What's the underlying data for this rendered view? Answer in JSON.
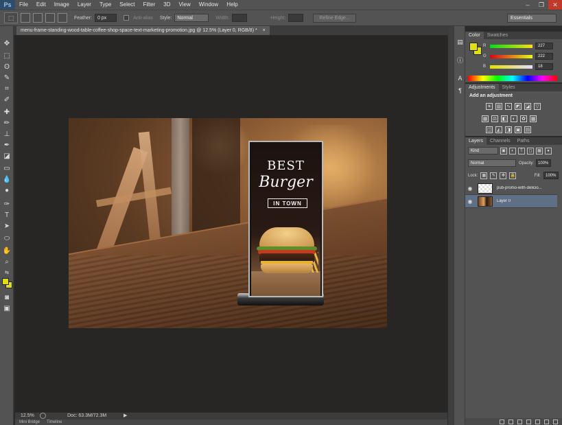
{
  "menubar": {
    "logo": "Ps",
    "items": [
      "File",
      "Edit",
      "Image",
      "Layer",
      "Type",
      "Select",
      "Filter",
      "3D",
      "View",
      "Window",
      "Help"
    ],
    "window_controls": [
      "–",
      "❐",
      "✕"
    ]
  },
  "options": {
    "feather_label": "Feather:",
    "feather_value": "0 px",
    "antialias_label": "Anti-alias",
    "style_label": "Style:",
    "style_value": "Normal",
    "width_label": "Width:",
    "height_label": "Height:",
    "refine_edge": "Refine Edge...",
    "workspace": "Essentials"
  },
  "document": {
    "tab_title": "menu-frame-standing-wood-table-coffee-shop-space-text-marketing-promotion.jpg @ 12.5% (Layer 0, RGB/8) *",
    "tab_close": "×",
    "zoom": "12.5%",
    "doc_size": "Doc: 63.3M/72.3M",
    "bottom_tabs": [
      "Mini Bridge",
      "Timeline"
    ]
  },
  "artwork": {
    "line1": "BEST",
    "line2": "Burger",
    "line3": "IN TOWN"
  },
  "color_panel": {
    "tabs": [
      "Color",
      "Swatches"
    ],
    "r_label": "R",
    "g_label": "G",
    "b_label": "B",
    "r_value": "227",
    "g_value": "222",
    "b_value": "18",
    "fg_color": "#e3de12"
  },
  "adjustments_panel": {
    "tabs": [
      "Adjustments",
      "Styles"
    ],
    "title": "Add an adjustment"
  },
  "layers_panel": {
    "tabs": [
      "Layers",
      "Channels",
      "Paths"
    ],
    "kind": "Kind",
    "blend_mode": "Normal",
    "opacity_label": "Opacity:",
    "opacity_value": "100%",
    "lock_label": "Lock:",
    "fill_label": "Fill:",
    "fill_value": "100%",
    "layers": [
      {
        "name": "pub-promo-with-delicio...",
        "selected": false
      },
      {
        "name": "Layer 0",
        "selected": true
      }
    ]
  }
}
